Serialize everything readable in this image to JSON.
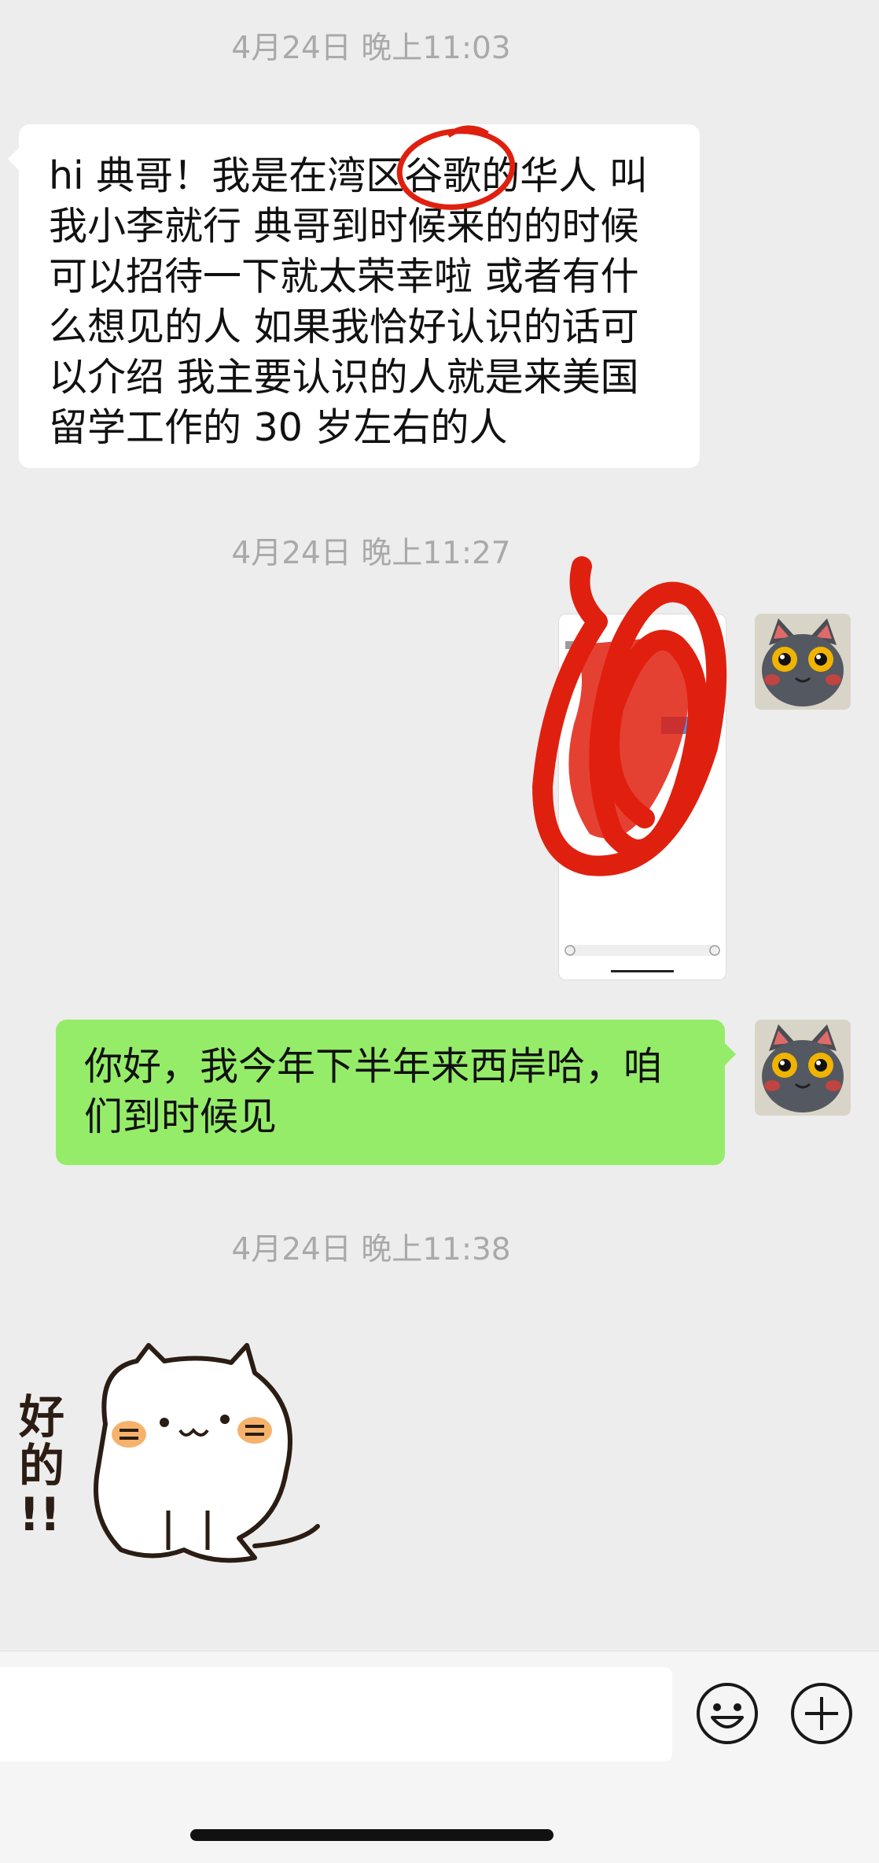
{
  "chat": {
    "messages": [
      {
        "type": "timestamp",
        "text": "4月24日 晚上11:03"
      },
      {
        "type": "incoming_text",
        "lines": [
          "hi 典哥！我是在湾区谷歌的华人 叫",
          "我小李就行 典哥到时候来的的时候",
          "可以招待一下就太荣幸啦 或者有什",
          "么想见的人 如果我恰好认识的话可",
          "以介绍 我主要认识的人就是来美国",
          "留学工作的 30 岁左右的人"
        ]
      },
      {
        "type": "timestamp",
        "text": "4月24日 晚上11:27"
      },
      {
        "type": "outgoing_image",
        "description": "redacted-screenshot"
      },
      {
        "type": "outgoing_text",
        "lines": [
          "你好，我今年下半年来西岸哈，咱",
          "们到时候见"
        ]
      },
      {
        "type": "timestamp",
        "text": "4月24日 晚上11:38"
      },
      {
        "type": "incoming_sticker",
        "sticker_text": [
          "好",
          "的",
          "!!"
        ]
      }
    ]
  },
  "input_bar": {
    "input_value": "",
    "icons": [
      "emoji-icon",
      "plus-icon"
    ]
  },
  "colors": {
    "background": "#ededed",
    "incoming_bubble": "#ffffff",
    "outgoing_bubble": "#95ec69",
    "timestamp": "#a9a9a9",
    "redaction": "#e0200f"
  }
}
